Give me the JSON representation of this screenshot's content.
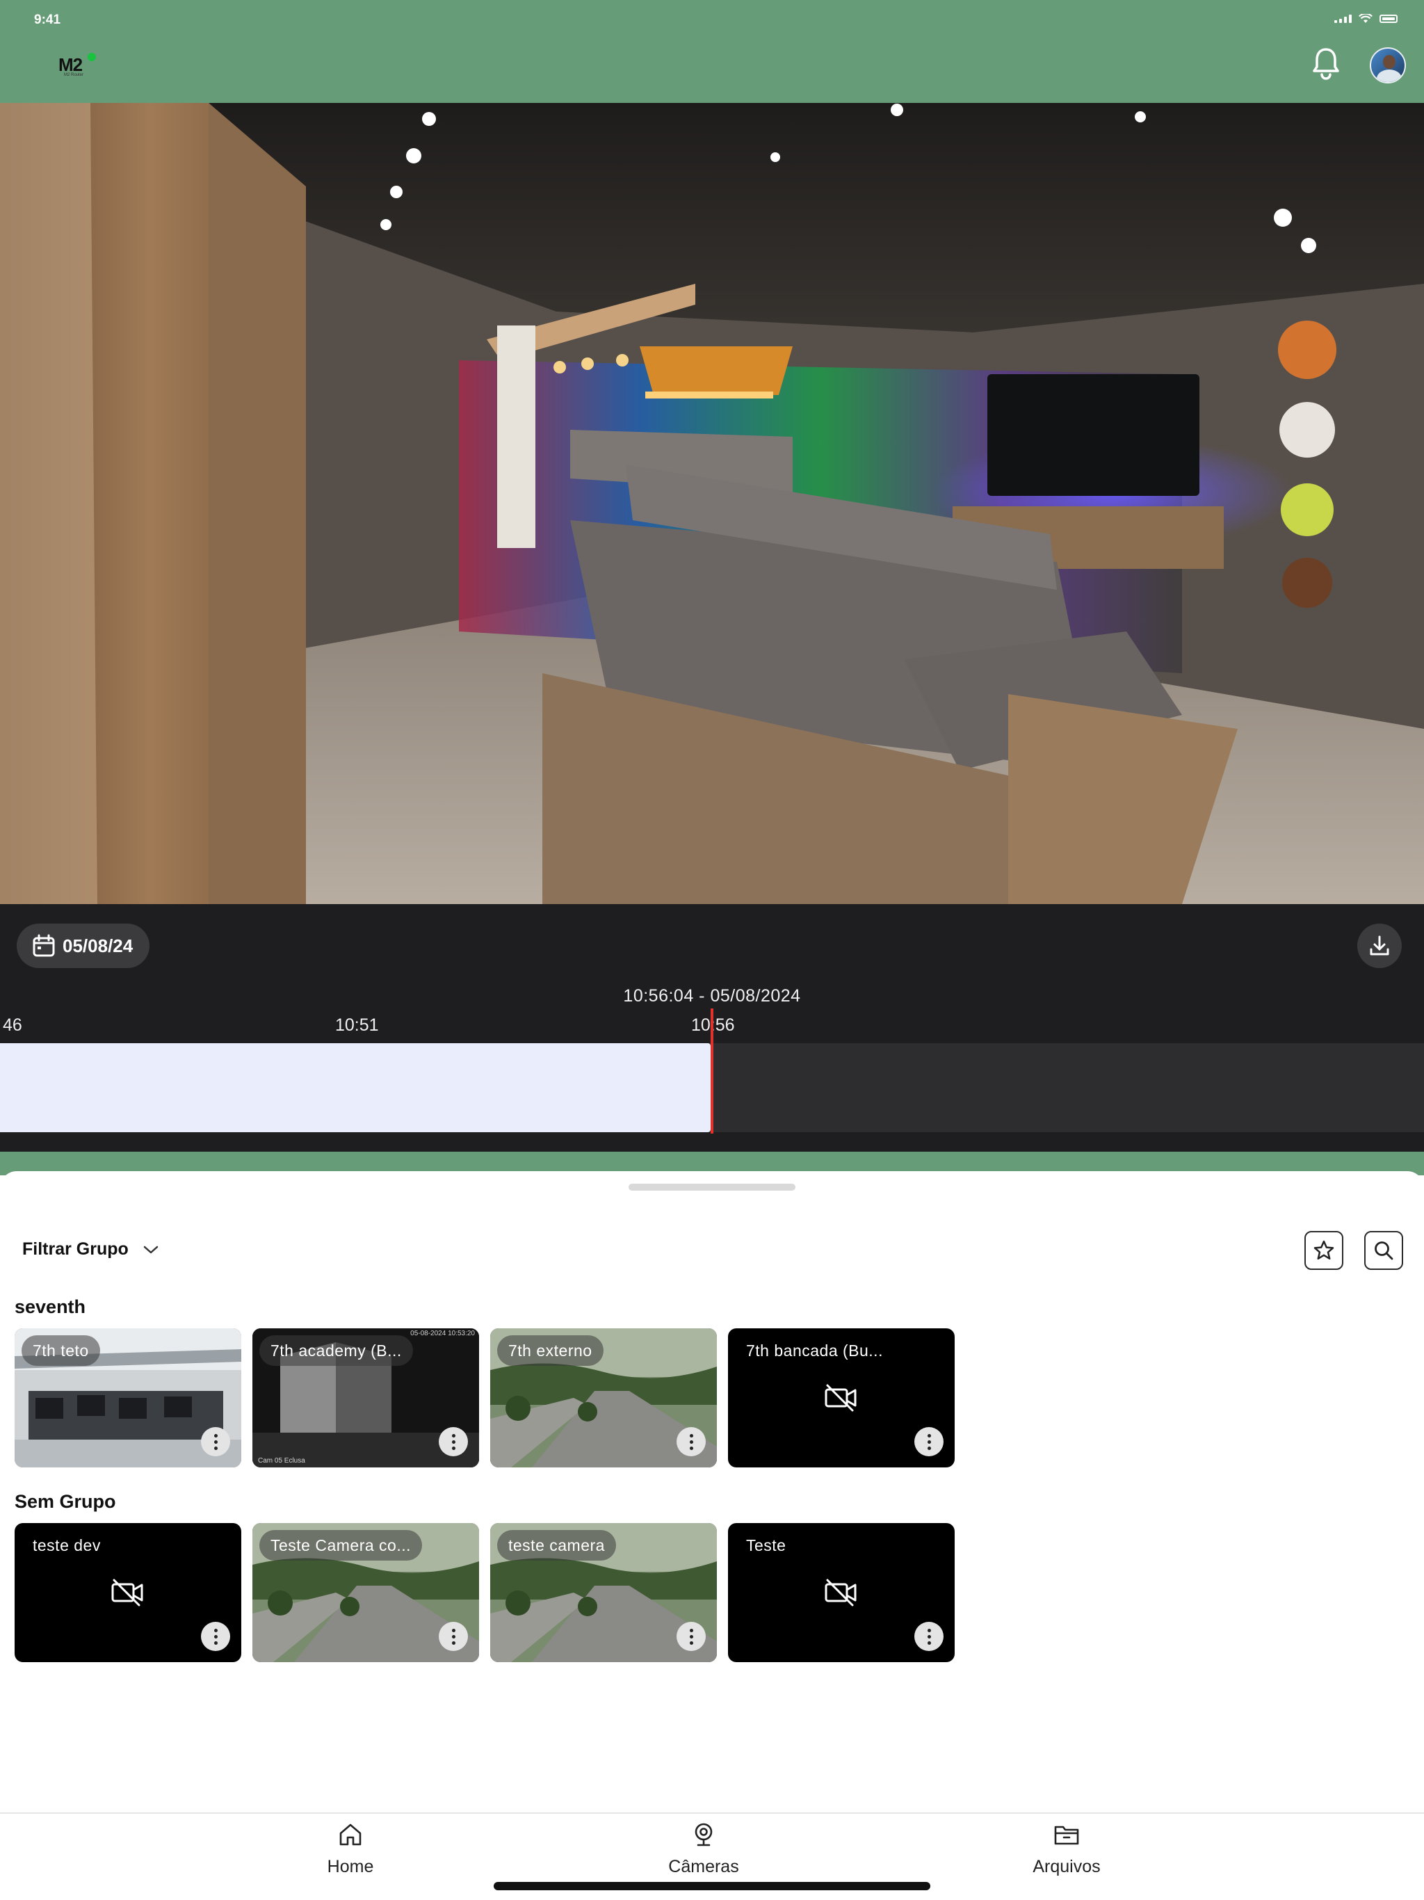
{
  "status_bar": {
    "time": "9:41"
  },
  "header": {
    "logo_text": "M2",
    "logo_subtext": "M2 Router",
    "brand_accent": "#19c340",
    "bar_color": "#679c78",
    "icons": [
      "bell-icon",
      "avatar"
    ]
  },
  "player": {
    "date": "05/08/24",
    "current_time": "10:56:04 - 05/08/2024",
    "timeline_ticks": [
      "46",
      "10:51",
      "10:56"
    ],
    "recorded_fraction": 0.499,
    "playhead_color": "#e0312b"
  },
  "camera_sheet": {
    "filter_label": "Filtrar Grupo",
    "groups": [
      {
        "name": "seventh",
        "cameras": [
          {
            "name": "7th teto",
            "status": "online"
          },
          {
            "name": "7th academy (B...",
            "status": "online",
            "overlay_date": "05-08-2024 10:53:20",
            "overlay_name": "Cam 05 Eclusa"
          },
          {
            "name": "7th externo",
            "status": "online"
          },
          {
            "name": "7th bancada (Bu...",
            "status": "offline"
          }
        ]
      },
      {
        "name": "Sem Grupo",
        "cameras": [
          {
            "name": "teste dev",
            "status": "offline"
          },
          {
            "name": "Teste Camera co...",
            "status": "online"
          },
          {
            "name": "teste camera",
            "status": "online"
          },
          {
            "name": "Teste",
            "status": "offline"
          }
        ]
      }
    ]
  },
  "tabbar": {
    "tabs": [
      {
        "label": "Home",
        "icon": "home-icon"
      },
      {
        "label": "Câmeras",
        "icon": "webcam-icon",
        "active": true
      },
      {
        "label": "Arquivos",
        "icon": "folder-icon"
      }
    ]
  }
}
